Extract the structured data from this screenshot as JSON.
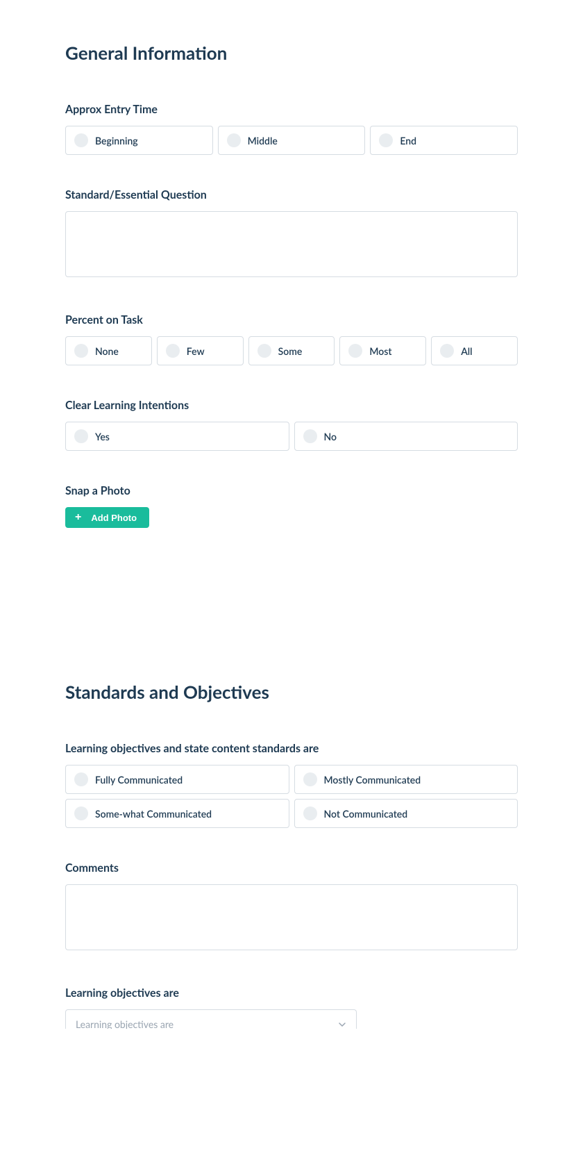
{
  "section1": {
    "title": "General Information",
    "entry_time": {
      "label": "Approx Entry Time",
      "options": [
        "Beginning",
        "Middle",
        "End"
      ]
    },
    "essential_question": {
      "label": "Standard/Essential Question",
      "value": ""
    },
    "percent_on_task": {
      "label": "Percent on Task",
      "options": [
        "None",
        "Few",
        "Some",
        "Most",
        "All"
      ]
    },
    "clear_intentions": {
      "label": "Clear Learning Intentions",
      "options": [
        "Yes",
        "No"
      ]
    },
    "photo": {
      "label": "Snap a Photo",
      "button": "Add Photo"
    }
  },
  "section2": {
    "title": "Standards and Objectives",
    "objectives_standards": {
      "label": "Learning objectives and state content standards are",
      "options": [
        "Fully Communicated",
        "Mostly Communicated",
        "Some-what Communicated",
        "Not Communicated"
      ]
    },
    "comments": {
      "label": "Comments",
      "value": ""
    },
    "learning_objectives": {
      "label": "Learning objectives are",
      "placeholder": "Learning objectives are"
    }
  }
}
